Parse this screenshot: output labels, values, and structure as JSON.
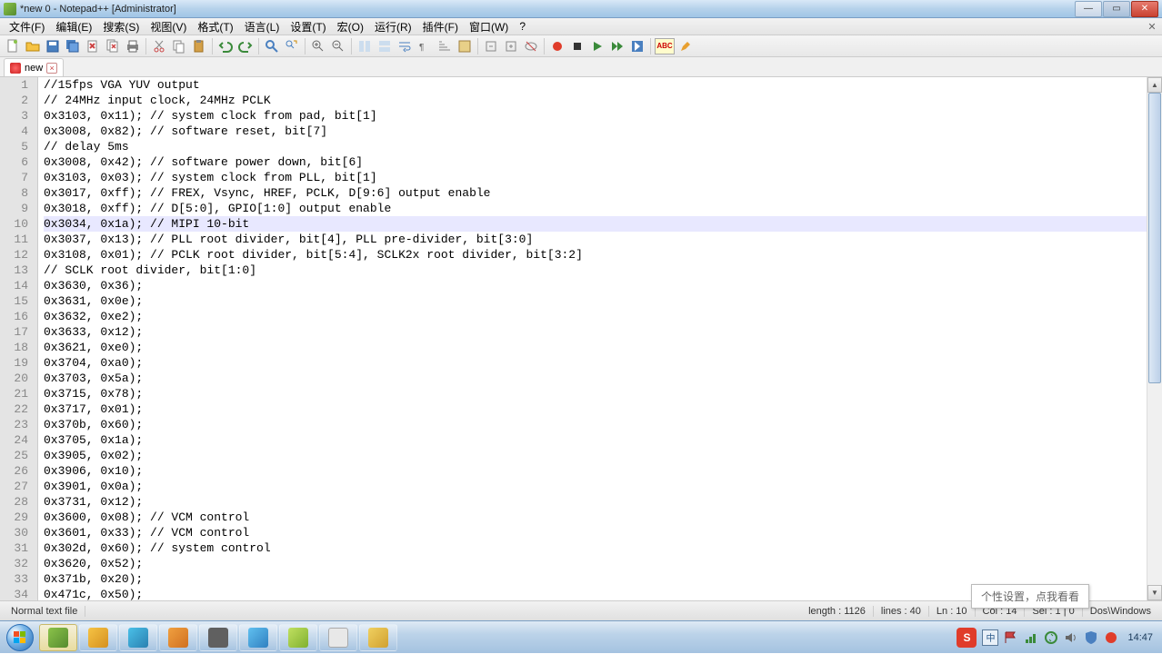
{
  "window": {
    "title": "*new  0 - Notepad++ [Administrator]"
  },
  "menu": {
    "file": "文件(F)",
    "edit": "编辑(E)",
    "search": "搜索(S)",
    "view": "视图(V)",
    "format": "格式(T)",
    "lang": "语言(L)",
    "settings": "设置(T)",
    "macro": "宏(O)",
    "run": "运行(R)",
    "plugins": "插件(F)",
    "window": "窗口(W)",
    "help": "?"
  },
  "tab": {
    "name": "new",
    "close": "×"
  },
  "code_lines": [
    "//15fps VGA YUV output",
    "// 24MHz input clock, 24MHz PCLK",
    "0x3103, 0x11); // system clock from pad, bit[1]",
    "0x3008, 0x82); // software reset, bit[7]",
    "// delay 5ms",
    "0x3008, 0x42); // software power down, bit[6]",
    "0x3103, 0x03); // system clock from PLL, bit[1]",
    "0x3017, 0xff); // FREX, Vsync, HREF, PCLK, D[9:6] output enable",
    "0x3018, 0xff); // D[5:0], GPIO[1:0] output enable",
    "0x3034, 0x1a); // MIPI 10-bit",
    "0x3037, 0x13); // PLL root divider, bit[4], PLL pre-divider, bit[3:0]",
    "0x3108, 0x01); // PCLK root divider, bit[5:4], SCLK2x root divider, bit[3:2]",
    "// SCLK root divider, bit[1:0]",
    "0x3630, 0x36);",
    "0x3631, 0x0e);",
    "0x3632, 0xe2);",
    "0x3633, 0x12);",
    "0x3621, 0xe0);",
    "0x3704, 0xa0);",
    "0x3703, 0x5a);",
    "0x3715, 0x78);",
    "0x3717, 0x01);",
    "0x370b, 0x60);",
    "0x3705, 0x1a);",
    "0x3905, 0x02);",
    "0x3906, 0x10);",
    "0x3901, 0x0a);",
    "0x3731, 0x12);",
    "0x3600, 0x08); // VCM control",
    "0x3601, 0x33); // VCM control",
    "0x302d, 0x60); // system control",
    "0x3620, 0x52);",
    "0x371b, 0x20);",
    "0x471c, 0x50);"
  ],
  "active_line_index": 9,
  "tooltip": "个性设置，点我看看",
  "status": {
    "filetype": "Normal text file",
    "length": "length : 1126",
    "lines": "lines : 40",
    "ln": "Ln : 10",
    "col": "Col : 14",
    "sel": "Sel : 1 | 0",
    "encoding": "Dos\\Windows"
  },
  "tray": {
    "time": "14:47",
    "ime_s": "S",
    "ime_cn": "中"
  },
  "icons": {
    "new": "new-file",
    "open": "open",
    "save": "save",
    "saveall": "save-all",
    "close": "close",
    "closeall": "close-all",
    "print": "print",
    "cut": "cut",
    "copy": "copy",
    "paste": "paste",
    "undo": "undo",
    "redo": "redo",
    "find": "find",
    "replace": "replace",
    "zoomin": "zoom-in",
    "zoomout": "zoom-out",
    "sync": "sync",
    "wrap": "wrap",
    "allchars": "show-all",
    "indent": "indent-guide",
    "ud": "user-lang",
    "foldall": "fold",
    "unfoldall": "unfold",
    "hidelines": "hide-lines",
    "record": "record",
    "play": "play",
    "stop": "stop",
    "playfast": "play-multi",
    "saverec": "save-macro",
    "abc": "ABC",
    "missile": "launch"
  }
}
